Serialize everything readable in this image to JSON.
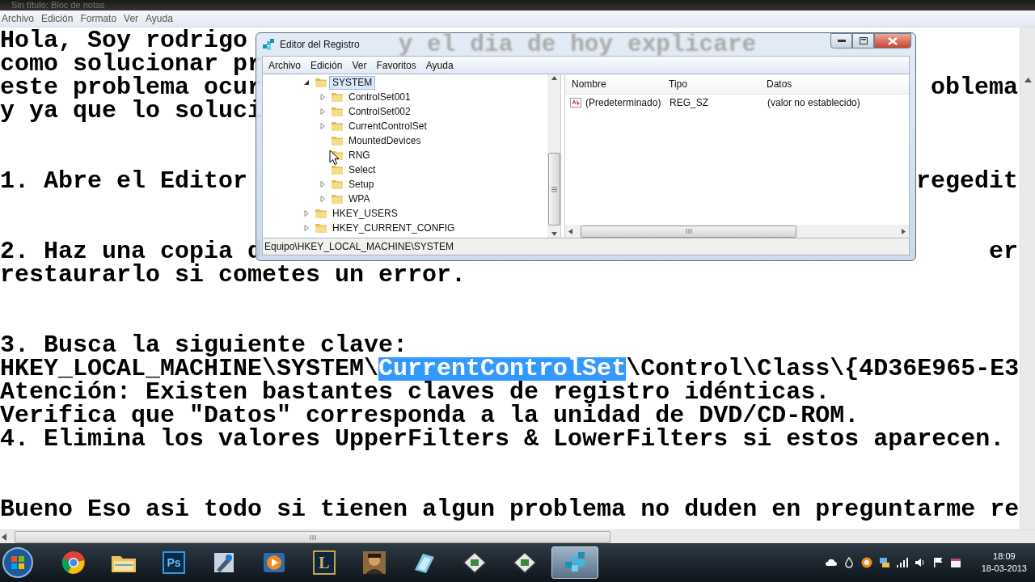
{
  "notepad": {
    "title": "Sin título: Bloc de notas",
    "menu": [
      "Archivo",
      "Edición",
      "Formato",
      "Ver",
      "Ayuda"
    ],
    "lines": [
      {
        "left": [
          {
            "text": "Hola, Soy rodrigo",
            "selected": false
          }
        ]
      },
      {
        "left": [
          {
            "text": "como solucionar pr",
            "selected": false
          }
        ]
      },
      {
        "left": [
          {
            "text": "este problema ocur",
            "selected": false
          }
        ],
        "right": "oblema"
      },
      {
        "left": [
          {
            "text": "y ya que lo soluci",
            "selected": false
          }
        ]
      },
      {
        "kind": "blank"
      },
      {
        "kind": "blank"
      },
      {
        "left": [
          {
            "text": "1. Abre el Editor",
            "selected": false
          }
        ],
        "right": "regedit"
      },
      {
        "kind": "blank"
      },
      {
        "kind": "blank"
      },
      {
        "left": [
          {
            "text": "2. Haz una copia d",
            "selected": false
          }
        ],
        "right": "er"
      },
      {
        "left": [
          {
            "text": "restaurarlo si cometes un error.",
            "selected": false
          }
        ]
      },
      {
        "kind": "blank"
      },
      {
        "kind": "blank"
      },
      {
        "left": [
          {
            "text": "3. Busca la siguiente clave:",
            "selected": false
          }
        ]
      },
      {
        "left": [
          {
            "text": "HKEY_LOCAL_MACHINE\\SYSTEM\\",
            "selected": false
          },
          {
            "text": "CurrentControlSet",
            "selected": true
          },
          {
            "text": "\\Control\\Class\\{4D36E965-E3",
            "selected": false
          }
        ]
      },
      {
        "left": [
          {
            "text": "Atención: Existen bastantes claves de registro idénticas.",
            "selected": false
          }
        ]
      },
      {
        "left": [
          {
            "text": "Verifica que \"Datos\" corresponda a la unidad de DVD/CD-ROM.",
            "selected": false
          }
        ]
      },
      {
        "left": [
          {
            "text": "4. Elimina los valores UpperFilters & LowerFilters si estos aparecen.",
            "selected": false
          }
        ]
      },
      {
        "kind": "blank"
      },
      {
        "kind": "blank"
      },
      {
        "left": [
          {
            "text": "Bueno Eso asi todo si tienen algun problema no duden en preguntarme re",
            "selected": false
          }
        ]
      }
    ]
  },
  "regedit": {
    "title": "Editor del Registro",
    "backdrop_text": "y el dia de hoy explicare",
    "menu": [
      "Archivo",
      "Edición",
      "Ver",
      "Favoritos",
      "Ayuda"
    ],
    "tree": [
      {
        "label": "SYSTEM",
        "expanded": true,
        "selected": true,
        "children": [
          {
            "label": "ControlSet001",
            "expanded": false,
            "selected": false
          },
          {
            "label": "ControlSet002",
            "expanded": false,
            "selected": false
          },
          {
            "label": "CurrentControlSet",
            "expanded": false,
            "selected": false
          },
          {
            "label": "MountedDevices",
            "selected": false
          },
          {
            "label": "RNG",
            "selected": false
          },
          {
            "label": "Select",
            "selected": false
          },
          {
            "label": "Setup",
            "expanded": false,
            "selected": false
          },
          {
            "label": "WPA",
            "expanded": false,
            "selected": false
          }
        ]
      },
      {
        "label": "HKEY_USERS",
        "expanded": false,
        "selected": false
      },
      {
        "label": "HKEY_CURRENT_CONFIG",
        "expanded": false,
        "selected": false
      }
    ],
    "columns": [
      "Nombre",
      "Tipo",
      "Datos"
    ],
    "rows": [
      [
        "(Predeterminado)",
        "REG_SZ",
        "(valor no establecido)"
      ]
    ],
    "status": "Equipo\\HKEY_LOCAL_MACHINE\\SYSTEM"
  },
  "taskbar": {
    "buttons": [
      {
        "kind": "browser",
        "selected": false
      },
      {
        "kind": "folder",
        "selected": false
      },
      {
        "kind": "text",
        "label": "Ps",
        "selected": false
      },
      {
        "kind": "tool",
        "selected": false
      },
      {
        "kind": "media",
        "selected": false
      },
      {
        "kind": "text",
        "label": "L",
        "selected": false
      },
      {
        "kind": "person",
        "selected": false
      },
      {
        "kind": "notepad",
        "selected": false
      },
      {
        "kind": "diamond",
        "selected": false
      },
      {
        "kind": "diamond",
        "selected": false
      },
      {
        "kind": "cubes",
        "selected": true
      }
    ],
    "time": "18:09",
    "date": "18-03-2013"
  }
}
